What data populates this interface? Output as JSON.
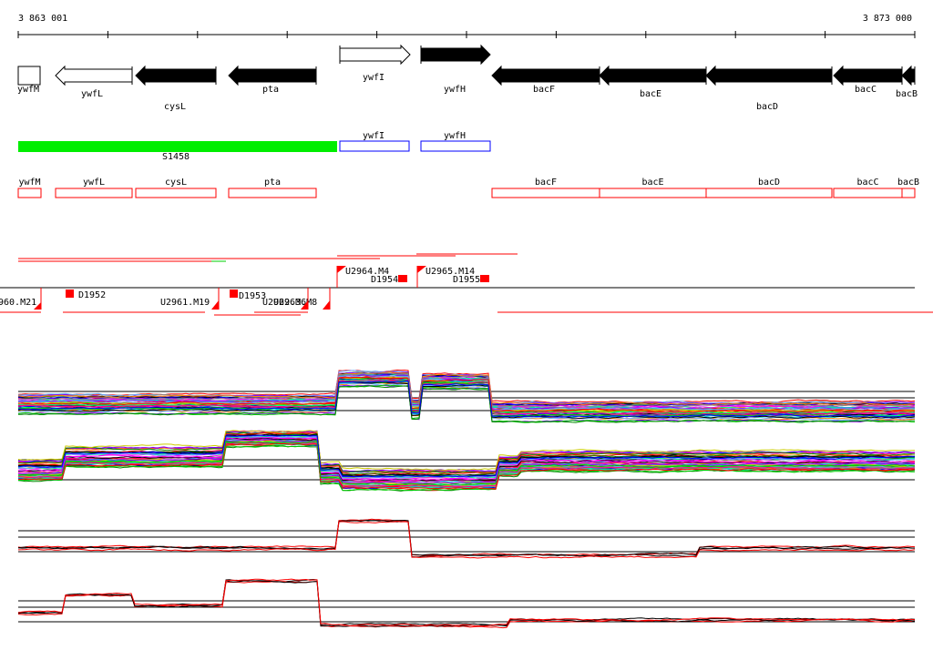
{
  "ruler": {
    "start": "3 863 001",
    "end": "3 873 000"
  },
  "genes": [
    {
      "name": "ywfM",
      "strand": "box",
      "fill": "white"
    },
    {
      "name": "ywfL",
      "strand": "-",
      "fill": "white"
    },
    {
      "name": "cysL",
      "strand": "-",
      "fill": "black"
    },
    {
      "name": "pta",
      "strand": "-",
      "fill": "black"
    },
    {
      "name": "ywfI",
      "strand": "+",
      "fill": "white"
    },
    {
      "name": "ywfH",
      "strand": "+",
      "fill": "black"
    },
    {
      "name": "bacF",
      "strand": "-",
      "fill": "black"
    },
    {
      "name": "bacE",
      "strand": "-",
      "fill": "black"
    },
    {
      "name": "bacD",
      "strand": "-",
      "fill": "black"
    },
    {
      "name": "bacC",
      "strand": "-",
      "fill": "black"
    },
    {
      "name": "bacB",
      "strand": "-",
      "fill": "black"
    }
  ],
  "segments": {
    "green": "S1458",
    "blue": [
      "ywfI",
      "ywfH"
    ]
  },
  "red_boxes": [
    "ywfM",
    "ywfL",
    "cysL",
    "pta",
    "bacF",
    "bacE",
    "bacD",
    "bacC",
    "bacB"
  ],
  "features": {
    "upper": [
      "U2964.M4",
      "D1954",
      "U2965.M14",
      "D1955"
    ],
    "lower": [
      "960.M21",
      "D1952",
      "U2961.M19",
      "D1953",
      "U2962.M6",
      "U2963.M8"
    ]
  },
  "colors": {
    "green": "#00ee00",
    "blue": "#0000ff",
    "red": "#ff0000"
  }
}
